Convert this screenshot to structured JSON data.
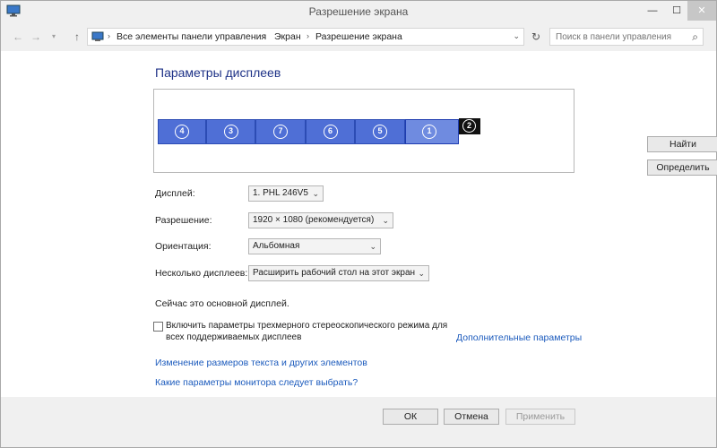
{
  "window": {
    "title": "Разрешение экрана",
    "minimize_glyph": "—",
    "maximize_glyph": "☐",
    "close_glyph": "✕"
  },
  "nav": {
    "back_glyph": "←",
    "forward_glyph": "→",
    "history_glyph": "▾",
    "up_glyph": "↑",
    "breadcrumbs": [
      "Все элементы панели управления",
      "Экран",
      "Разрешение экрана"
    ],
    "crumb_separator": "›",
    "dropdown_glyph": "⌄",
    "refresh_glyph": "↻",
    "search_placeholder": "Поиск в панели управления",
    "search_glyph": "⌕"
  },
  "display_panel": {
    "heading": "Параметры дисплеев",
    "monitors": [
      "4",
      "3",
      "7",
      "6",
      "5",
      "1"
    ],
    "small_monitor": "2",
    "find_label": "Найти",
    "identify_label": "Определить"
  },
  "settings": {
    "display": {
      "label": "Дисплей:",
      "value": "1. PHL 246V5"
    },
    "resolution": {
      "label": "Разрешение:",
      "value": "1920 × 1080 (рекомендуется)"
    },
    "orientation": {
      "label": "Ориентация:",
      "value": "Альбомная"
    },
    "multiple_displays": {
      "label": "Несколько дисплеев:",
      "value": "Расширить рабочий стол на этот экран"
    },
    "chevron_glyph": "⌄"
  },
  "status": "Сейчас это основной дисплей.",
  "stereo_checkbox": {
    "label": "Включить параметры трехмерного стереоскопического режима для всех поддерживаемых дисплеев",
    "checked": false
  },
  "links": {
    "advanced": "Дополнительные параметры",
    "text_size": "Изменение размеров текста и других элементов",
    "which_settings": "Какие параметры монитора следует выбрать?"
  },
  "buttons": {
    "ok": "ОК",
    "cancel": "Отмена",
    "apply": "Применить"
  },
  "colors": {
    "monitor_fill": "#4f6fd6",
    "link": "#1c5bbd",
    "heading": "#1e3287"
  }
}
